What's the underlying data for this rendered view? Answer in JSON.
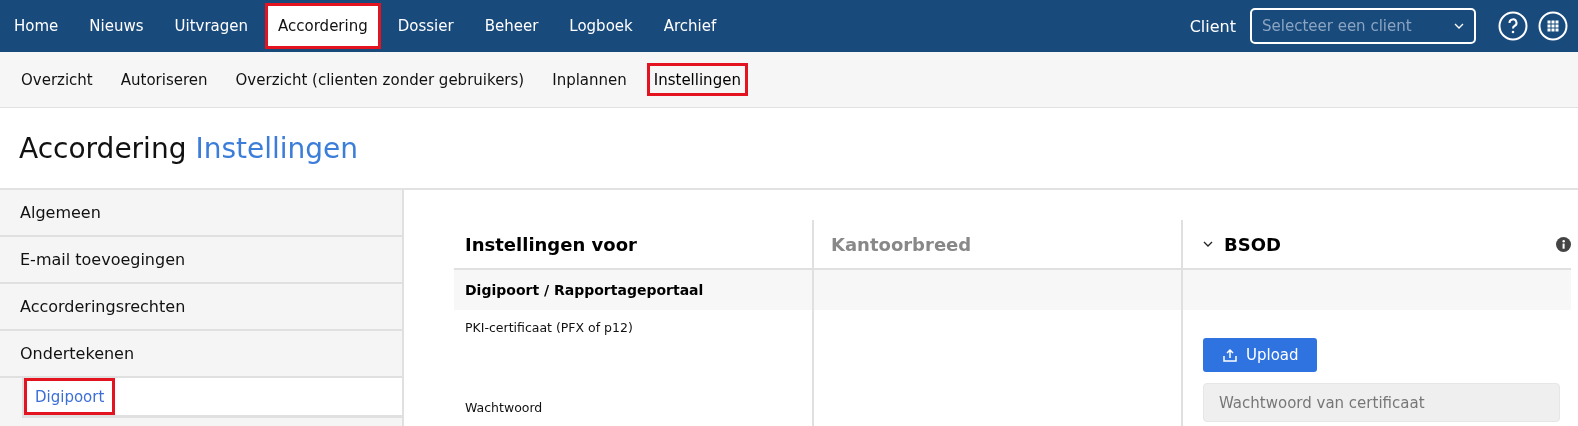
{
  "topnav": {
    "items": [
      {
        "label": "Home",
        "selected": false,
        "highlighted": false
      },
      {
        "label": "Nieuws",
        "selected": false,
        "highlighted": false
      },
      {
        "label": "Uitvragen",
        "selected": false,
        "highlighted": false
      },
      {
        "label": "Accordering",
        "selected": true,
        "highlighted": true
      },
      {
        "label": "Dossier",
        "selected": false,
        "highlighted": false
      },
      {
        "label": "Beheer",
        "selected": false,
        "highlighted": false
      },
      {
        "label": "Logboek",
        "selected": false,
        "highlighted": false
      },
      {
        "label": "Archief",
        "selected": false,
        "highlighted": false
      }
    ],
    "client_label": "Client",
    "client_select": {
      "placeholder": "Selecteer een client"
    }
  },
  "subnav": {
    "items": [
      {
        "label": "Overzicht",
        "selected": false,
        "highlighted": false
      },
      {
        "label": "Autoriseren",
        "selected": false,
        "highlighted": false
      },
      {
        "label": "Overzicht (clienten zonder gebruikers)",
        "selected": false,
        "highlighted": false
      },
      {
        "label": "Inplannen",
        "selected": false,
        "highlighted": false
      },
      {
        "label": "Instellingen",
        "selected": true,
        "highlighted": true
      }
    ]
  },
  "page_title": {
    "main": "Accordering",
    "sub": "Instellingen"
  },
  "sidebar": {
    "items": [
      {
        "label": "Algemeen",
        "selected": false,
        "highlighted": false
      },
      {
        "label": "E-mail toevoegingen",
        "selected": false,
        "highlighted": false
      },
      {
        "label": "Accorderingsrechten",
        "selected": false,
        "highlighted": false
      },
      {
        "label": "Ondertekenen",
        "selected": false,
        "highlighted": false,
        "children": [
          {
            "label": "Digipoort",
            "selected": true,
            "highlighted": true
          }
        ]
      }
    ]
  },
  "table": {
    "columns": [
      {
        "label": "Instellingen voor",
        "kind": "setting"
      },
      {
        "label": "Kantoorbreed",
        "kind": "scope"
      },
      {
        "label": "BSOD",
        "kind": "client",
        "expanded": true
      }
    ],
    "sections": [
      {
        "title": "Digipoort / Rapportageportaal",
        "rows": [
          {
            "label": "PKI-certificaat (PFX of p12)",
            "control": {
              "kind": "upload",
              "label": "Upload"
            }
          },
          {
            "label": "Wachtwoord",
            "control": {
              "kind": "password",
              "placeholder": "Wachtwoord van certificaat"
            }
          }
        ]
      }
    ]
  }
}
